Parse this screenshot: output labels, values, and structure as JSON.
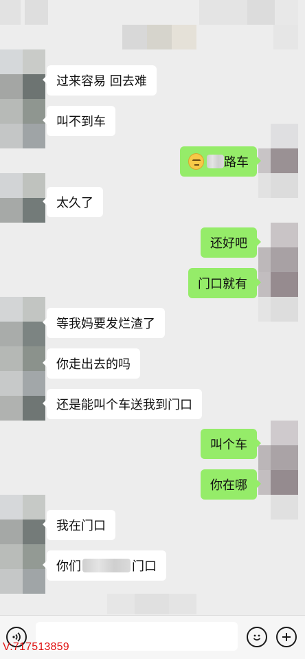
{
  "messages": [
    {
      "side": "left",
      "text": "过来容易 回去难"
    },
    {
      "side": "left",
      "text": "叫不到车"
    },
    {
      "side": "right",
      "text": "路车",
      "redacted_prefix": true,
      "emoji": "grimacing-face-icon"
    },
    {
      "side": "left",
      "text": "太久了"
    },
    {
      "side": "right",
      "text": "还好吧"
    },
    {
      "side": "right",
      "text": "门口就有"
    },
    {
      "side": "left",
      "text": "等我妈要发烂渣了"
    },
    {
      "side": "left",
      "text": "你走出去的吗"
    },
    {
      "side": "left",
      "text": "还是能叫个车送我到门口"
    },
    {
      "side": "right",
      "text": "叫个车"
    },
    {
      "side": "right",
      "text": "你在哪"
    },
    {
      "side": "left",
      "text": "我在门口"
    },
    {
      "side": "left",
      "text_before": "你们",
      "text_after": "门口",
      "redacted_middle": true
    }
  ],
  "input_bar": {
    "voice_icon": "voice-icon",
    "emoji_icon": "emoji-icon",
    "plus_icon": "plus-icon",
    "input_value": ""
  },
  "watermark": "V:717513859",
  "colors": {
    "background": "#ededed",
    "bubble_self": "#95ec69",
    "bubble_other": "#ffffff",
    "watermark": "#e01010"
  }
}
